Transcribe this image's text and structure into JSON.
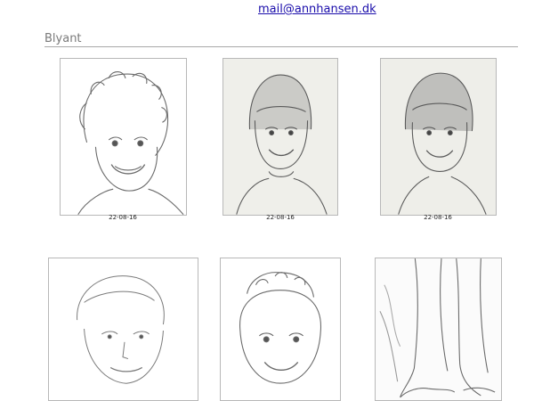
{
  "header": {
    "email": "mail@annhansen.dk"
  },
  "section": {
    "title": "Blyant"
  },
  "gallery": [
    {
      "name": "portrait-curly-girl",
      "date": "22-08-16"
    },
    {
      "name": "portrait-boy-bangs",
      "date": "22-08-16"
    },
    {
      "name": "portrait-boy-smiling",
      "date": "22-08-16"
    },
    {
      "name": "portrait-woman",
      "date": ""
    },
    {
      "name": "portrait-baby",
      "date": ""
    },
    {
      "name": "feet-study",
      "date": ""
    }
  ]
}
